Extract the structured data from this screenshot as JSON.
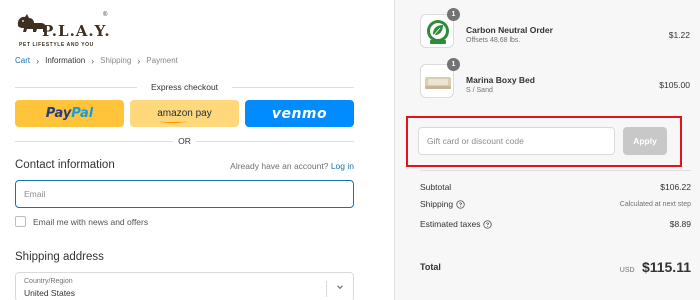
{
  "brand": {
    "logo_text": "P.L.A.Y.",
    "registered": "®",
    "tagline": "PET LIFESTYLE AND YOU"
  },
  "breadcrumb": {
    "items": [
      {
        "label": "Cart",
        "state": "link"
      },
      {
        "label": "Information",
        "state": "current"
      },
      {
        "label": "Shipping",
        "state": "upcoming"
      },
      {
        "label": "Payment",
        "state": "upcoming"
      }
    ],
    "separator": "›"
  },
  "express_checkout": {
    "heading": "Express checkout",
    "paypal": {
      "part1": "Pay",
      "part2": "Pal"
    },
    "amazon": {
      "label": "amazon pay"
    },
    "venmo": {
      "label": "venmo"
    },
    "or_label": "OR"
  },
  "contact": {
    "title": "Contact information",
    "account_prompt": "Already have an account?",
    "login_label": "Log in",
    "email_placeholder": "Email",
    "email_value": "",
    "newsletter_label": "Email me with news and offers",
    "newsletter_checked": false
  },
  "shipping": {
    "title": "Shipping address",
    "country_caption": "Country/Region",
    "country_value": "United States"
  },
  "order": {
    "items": [
      {
        "name": "Carbon Neutral Order",
        "sub": "Offsets 48.68 lbs.",
        "price": "$1.22",
        "qty": "1",
        "icon": "leaf-badge-icon"
      },
      {
        "name": "Marina Boxy Bed",
        "sub": "S / Sand",
        "price": "$105.00",
        "qty": "1",
        "icon": "pet-bed-image"
      }
    ],
    "discount": {
      "placeholder": "Gift card or discount code",
      "value": "",
      "apply_label": "Apply"
    },
    "subtotal": {
      "label": "Subtotal",
      "value": "$106.22"
    },
    "shipping": {
      "label": "Shipping",
      "value": "Calculated at next step"
    },
    "taxes": {
      "label": "Estimated taxes",
      "value": "$8.89"
    },
    "total": {
      "label": "Total",
      "currency": "USD",
      "value": "$115.11"
    }
  },
  "colors": {
    "link": "#1773b0",
    "paypal_bg": "#ffc439",
    "amazon_bg": "#ffd87c",
    "venmo_bg": "#008cff",
    "highlight": "#e5121b"
  }
}
